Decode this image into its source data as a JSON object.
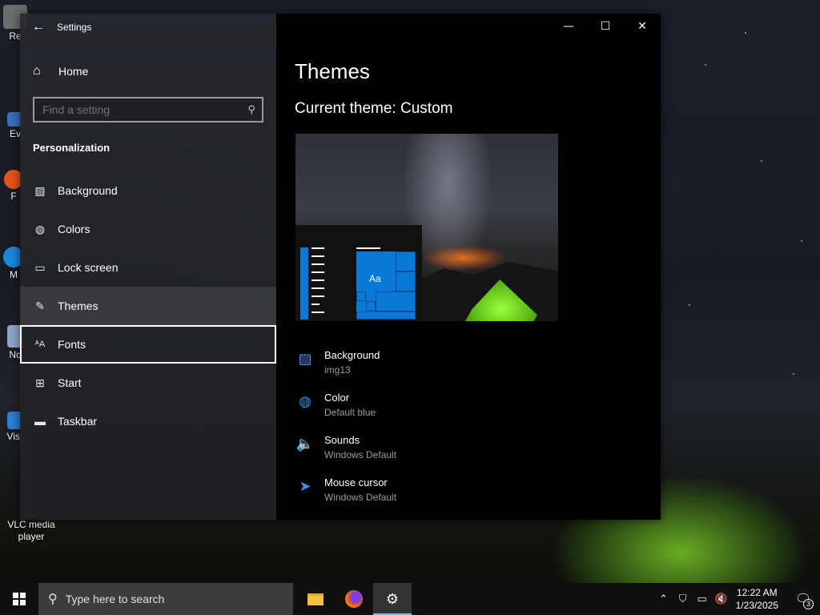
{
  "desktop": {
    "icons": [
      {
        "label": "Re",
        "icon": "recycle-bin-icon",
        "color": "#6d6d6d"
      },
      {
        "label": "Ev",
        "icon": "app-shortcut-icon",
        "color": "#3b6fbf"
      },
      {
        "label": "F",
        "icon": "firefox-icon",
        "color": "#e8551b"
      },
      {
        "label": "M",
        "icon": "edge-icon",
        "color": "#1b87d8"
      },
      {
        "label": "No",
        "icon": "notepad-icon",
        "color": "#8fa8c8"
      },
      {
        "label": "Visu",
        "icon": "visual-studio-icon",
        "color": "#2b7fd8"
      },
      {
        "label": "VLC media player",
        "icon": "vlc-icon",
        "color": "#e8850f"
      }
    ]
  },
  "settings": {
    "app_title": "Settings",
    "home_label": "Home",
    "search_placeholder": "Find a setting",
    "section": "Personalization",
    "nav": [
      {
        "label": "Background",
        "icon": "image-icon"
      },
      {
        "label": "Colors",
        "icon": "palette-icon"
      },
      {
        "label": "Lock screen",
        "icon": "lock-screen-icon"
      },
      {
        "label": "Themes",
        "icon": "brush-icon",
        "selected": true
      },
      {
        "label": "Fonts",
        "icon": "fonts-icon",
        "focused": true
      },
      {
        "label": "Start",
        "icon": "start-icon"
      },
      {
        "label": "Taskbar",
        "icon": "taskbar-icon"
      }
    ],
    "page_title": "Themes",
    "current_theme": "Current theme: Custom",
    "preview_sample_text": "Aa",
    "theme_items": [
      {
        "name": "Background",
        "value": "img13",
        "icon": "image-icon"
      },
      {
        "name": "Color",
        "value": "Default blue",
        "icon": "palette-icon"
      },
      {
        "name": "Sounds",
        "value": "Windows Default",
        "icon": "speaker-icon"
      },
      {
        "name": "Mouse cursor",
        "value": "Windows Default",
        "icon": "cursor-icon"
      }
    ],
    "accent_color": "#0a78d7"
  },
  "taskbar": {
    "search_placeholder": "Type here to search",
    "apps": [
      {
        "name": "file-explorer",
        "icon": "folder-icon"
      },
      {
        "name": "firefox",
        "icon": "firefox-icon"
      },
      {
        "name": "settings",
        "icon": "gear-icon",
        "active": true
      }
    ],
    "clock_time": "12:22 AM",
    "clock_date": "1/23/2025",
    "notification_count": "3"
  }
}
